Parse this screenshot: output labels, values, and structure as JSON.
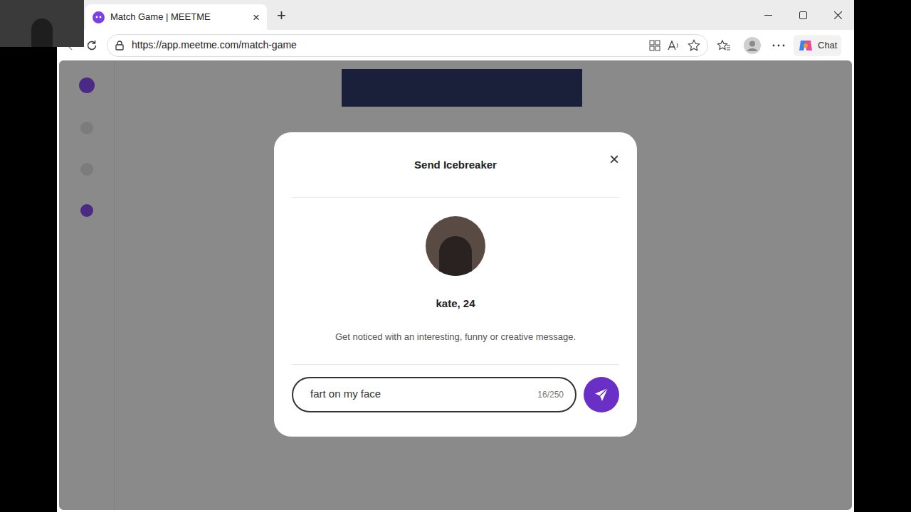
{
  "window": {
    "title": "Match Game | MEETME",
    "tab_close": "×",
    "new_tab": "+"
  },
  "address_bar": {
    "url": "https://app.meetme.com/match-game"
  },
  "toolbar": {
    "chat": "Chat"
  },
  "modal": {
    "title": "Send Icebreaker",
    "close": "×",
    "profile": {
      "name": "kate, 24"
    },
    "hint": "Get noticed with an interesting, funny or creative message.",
    "message": {
      "value": "fart on my face",
      "count": "16/250"
    }
  }
}
